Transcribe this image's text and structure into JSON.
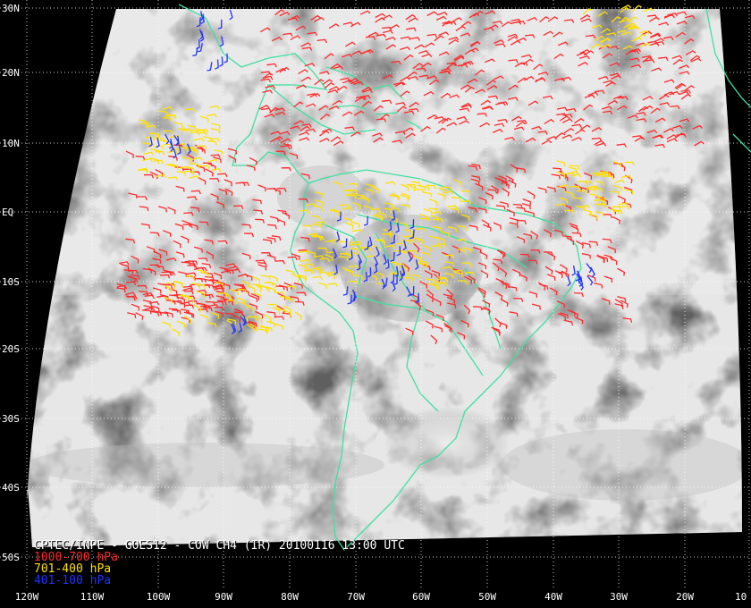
{
  "title": "CPTEC/INPE - GOES12 - COW CH4 (IR) 20100116 13:00 UTC",
  "legend": [
    {
      "label": "1000-700 hPa",
      "color": "#ff2a2a"
    },
    {
      "label": "701-400 hPa",
      "color": "#ffe000"
    },
    {
      "label": "401-100 hPa",
      "color": "#2233ff"
    }
  ],
  "lat_labels": [
    {
      "text": "30N"
    },
    {
      "text": "20N"
    },
    {
      "text": "10N"
    },
    {
      "text": "EQ"
    },
    {
      "text": "10S"
    },
    {
      "text": "20S"
    },
    {
      "text": "30S"
    },
    {
      "text": "40S"
    },
    {
      "text": "50S"
    }
  ],
  "lon_labels": [
    {
      "text": "120W"
    },
    {
      "text": "110W"
    },
    {
      "text": "100W"
    },
    {
      "text": "90W"
    },
    {
      "text": "80W"
    },
    {
      "text": "70W"
    },
    {
      "text": "60W"
    },
    {
      "text": "50W"
    },
    {
      "text": "40W"
    },
    {
      "text": "30W"
    },
    {
      "text": "20W"
    },
    {
      "text": "10"
    }
  ],
  "colors": {
    "coast": "#3fe0a0",
    "grid": "#ffffff",
    "background": "#000000"
  }
}
